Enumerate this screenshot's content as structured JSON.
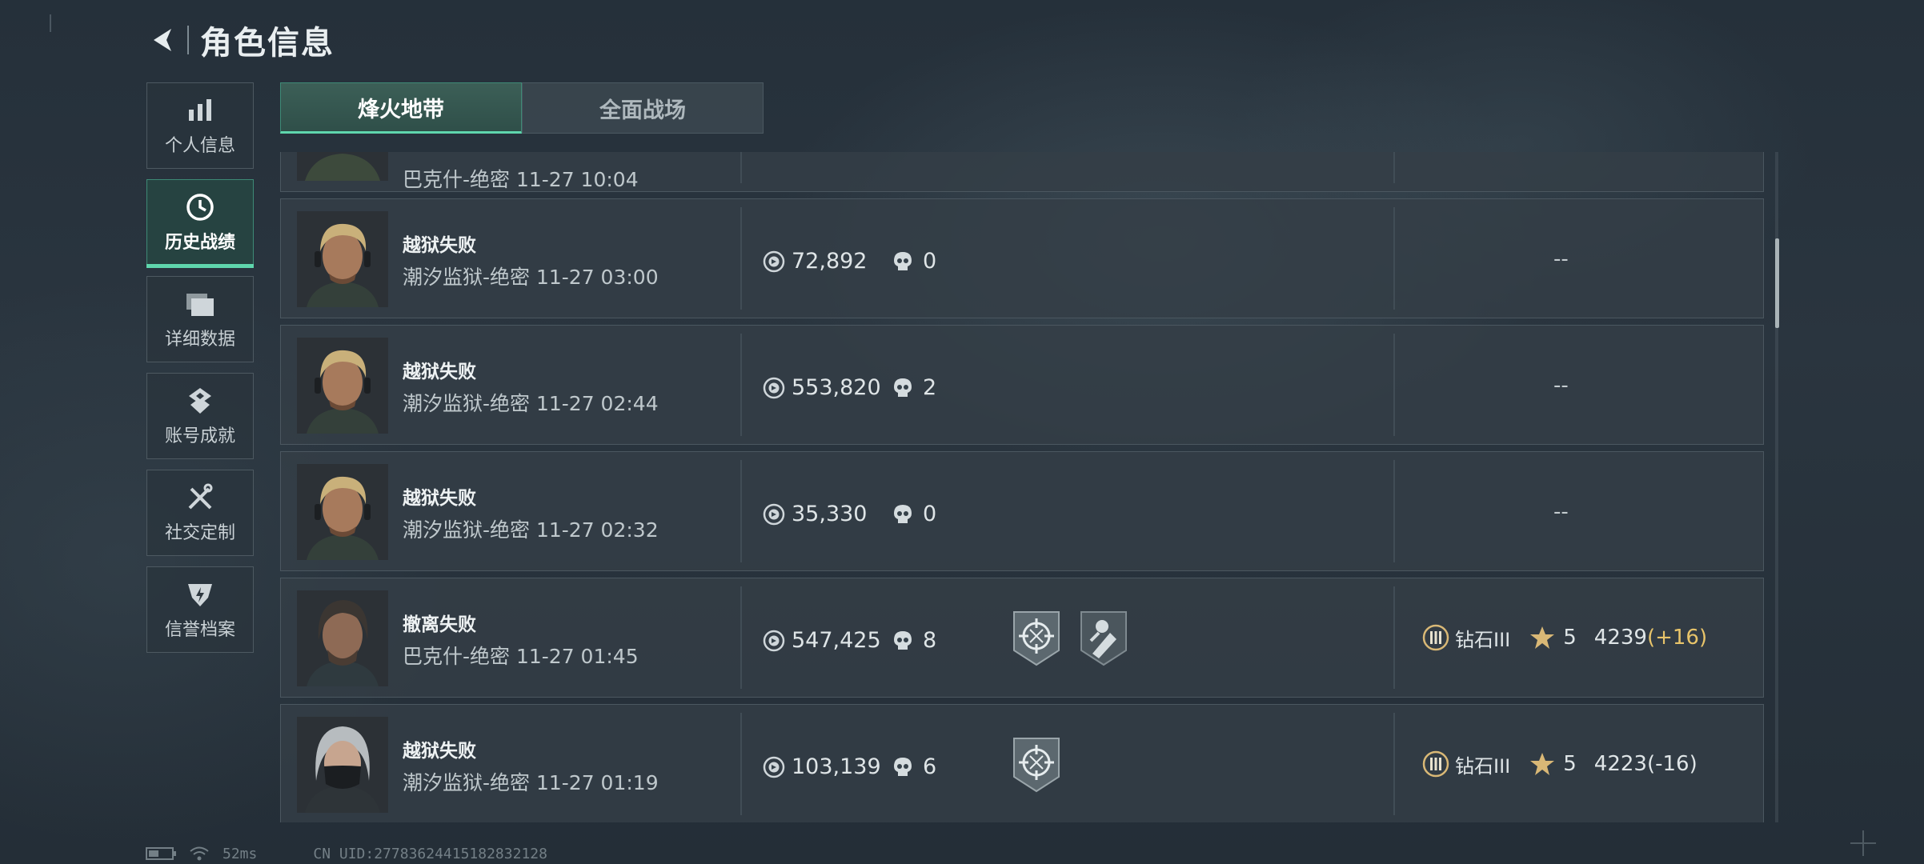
{
  "header": {
    "title": "角色信息",
    "back_icon": "back-arrow-icon"
  },
  "sidebar": {
    "items": [
      {
        "label": "个人信息",
        "icon": "bar-chart-icon",
        "active": false
      },
      {
        "label": "历史战绩",
        "icon": "clock-icon",
        "active": true
      },
      {
        "label": "详细数据",
        "icon": "folder-icon",
        "active": false
      },
      {
        "label": "账号成就",
        "icon": "medal-icon",
        "active": false
      },
      {
        "label": "社交定制",
        "icon": "tools-icon",
        "active": false
      },
      {
        "label": "信誉档案",
        "icon": "shield-icon",
        "active": false
      }
    ]
  },
  "tabs": [
    {
      "label": "烽火地带",
      "active": true
    },
    {
      "label": "全面战场",
      "active": false
    }
  ],
  "partial_row": {
    "detail": "巴克什-绝密 11-27 10:04"
  },
  "records": [
    {
      "result": "越狱失败",
      "detail": "潮汐监狱-绝密 11-27 03:00",
      "value": "72,892",
      "kills": "0",
      "badges": [],
      "rank": null,
      "placeholder": "--",
      "avatar": "blond-operator"
    },
    {
      "result": "越狱失败",
      "detail": "潮汐监狱-绝密 11-27 02:44",
      "value": "553,820",
      "kills": "2",
      "badges": [],
      "rank": null,
      "placeholder": "--",
      "avatar": "blond-operator"
    },
    {
      "result": "越狱失败",
      "detail": "潮汐监狱-绝密 11-27 02:32",
      "value": "35,330",
      "kills": "0",
      "badges": [],
      "rank": null,
      "placeholder": "--",
      "avatar": "blond-operator"
    },
    {
      "result": "撤离失败",
      "detail": "巴克什-绝密 11-27 01:45",
      "value": "547,425",
      "kills": "8",
      "badges": [
        "crosshair-badge-icon",
        "wrench-badge-icon"
      ],
      "rank": {
        "tier": "钻石III",
        "stars": "5",
        "score": "4239",
        "delta": "(+16)",
        "delta_sign": "pos"
      },
      "placeholder": "",
      "avatar": "dark-hair-operator"
    },
    {
      "result": "越狱失败",
      "detail": "潮汐监狱-绝密 11-27 01:19",
      "value": "103,139",
      "kills": "6",
      "badges": [
        "crosshair-badge-icon"
      ],
      "rank": {
        "tier": "钻石III",
        "stars": "5",
        "score": "4223",
        "delta": "(-16)",
        "delta_sign": "neg"
      },
      "placeholder": "",
      "avatar": "masked-operator"
    }
  ],
  "status_bar": {
    "ping": "52ms",
    "uid": "CN UID:27783624415182832128"
  },
  "colors": {
    "accent": "#5fd6ad",
    "delta_positive": "#e8c46a"
  }
}
